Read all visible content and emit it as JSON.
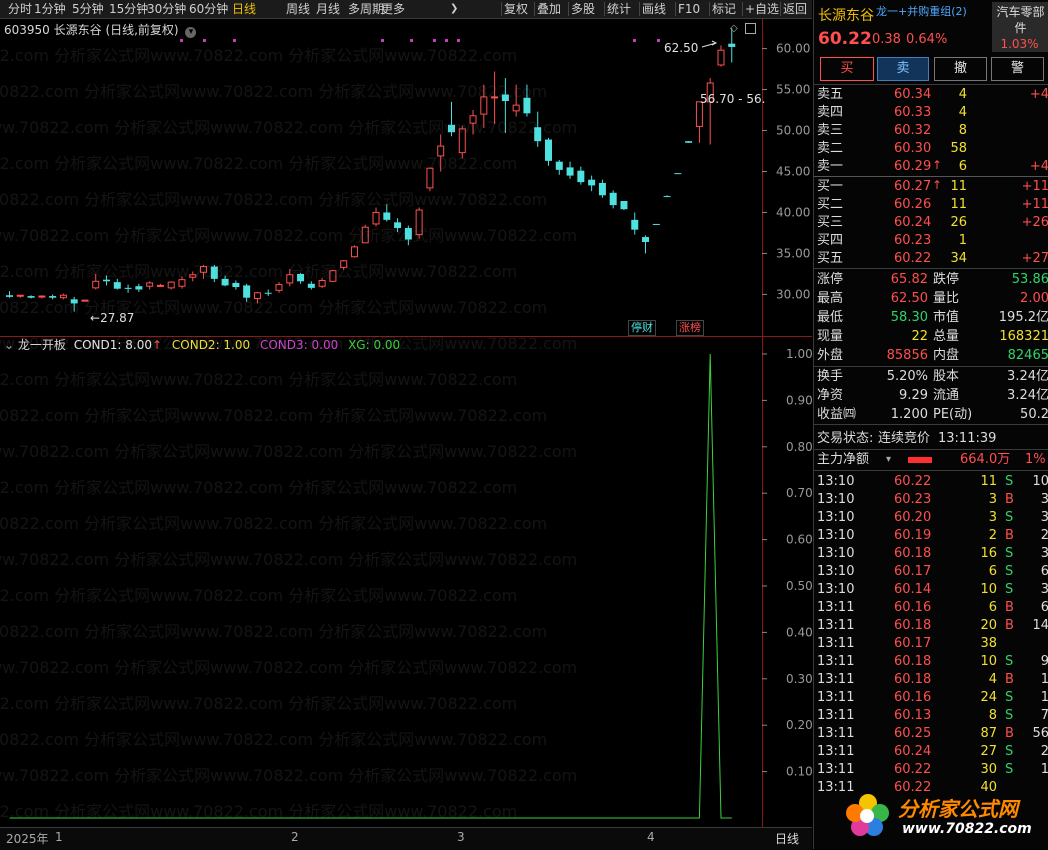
{
  "toolbar": {
    "periods": [
      "分时",
      "1分钟",
      "5分钟",
      "15分钟",
      "30分钟",
      "60分钟",
      "日线",
      "周线",
      "月线",
      "多周期",
      "更多"
    ],
    "active_period": "日线",
    "more_arrow": "❯",
    "actions": [
      "复权",
      "叠加",
      "多股",
      "统计",
      "画线",
      "F10",
      "标记",
      "+自选",
      "返回"
    ]
  },
  "chart": {
    "title": "603950 长源东谷 (日线,前复权)",
    "price_ticks": [
      "60.00",
      "55.00",
      "50.00",
      "45.00",
      "40.00",
      "35.00",
      "30.00"
    ],
    "high_label": "62.50",
    "low_label": "27.87",
    "right_label": "56.70 - 56.",
    "badge_tingcai": "停财",
    "badge_zhangbang": "涨榜"
  },
  "indicator": {
    "name": "龙一开板",
    "cond1": "COND1: 8.00",
    "cond1_arrow": "↑",
    "cond2": "COND2: 1.00",
    "cond3": "COND3: 0.00",
    "xg": "XG: 0.00",
    "ticks": [
      "1.00",
      "0.90",
      "0.80",
      "0.70",
      "0.60",
      "0.50",
      "0.40",
      "0.30",
      "0.20",
      "0.10"
    ]
  },
  "time_axis": {
    "year": "2025年",
    "months": [
      "1",
      "2",
      "3",
      "4"
    ],
    "period_label": "日线"
  },
  "stock": {
    "name": "长源东谷",
    "tags": "龙一+并购重组(2)",
    "sector": "汽车零部件",
    "sector_change": "1.03%",
    "price": "60.22",
    "change": "0.38",
    "change_pct": "0.64%"
  },
  "trade_buttons": [
    "买",
    "卖",
    "撤",
    "警"
  ],
  "asks": [
    {
      "label": "卖五",
      "price": "60.34",
      "vol": "4",
      "chg": "+4"
    },
    {
      "label": "卖四",
      "price": "60.33",
      "vol": "4",
      "chg": ""
    },
    {
      "label": "卖三",
      "price": "60.32",
      "vol": "8",
      "chg": ""
    },
    {
      "label": "卖二",
      "price": "60.30",
      "vol": "58",
      "chg": ""
    },
    {
      "label": "卖一",
      "price": "60.29",
      "vol": "6",
      "chg": "+4"
    }
  ],
  "bids": [
    {
      "label": "买一",
      "price": "60.27",
      "vol": "11",
      "chg": "+11"
    },
    {
      "label": "买二",
      "price": "60.26",
      "vol": "11",
      "chg": "+11"
    },
    {
      "label": "买三",
      "price": "60.24",
      "vol": "26",
      "chg": "+26"
    },
    {
      "label": "买四",
      "price": "60.23",
      "vol": "1",
      "chg": ""
    },
    {
      "label": "买五",
      "price": "60.22",
      "vol": "34",
      "chg": "+27"
    }
  ],
  "stats": [
    {
      "l1": "涨停",
      "v1": "65.82",
      "l2": "跌停",
      "v2": "53.86"
    },
    {
      "l1": "最高",
      "v1": "62.50",
      "l2": "量比",
      "v2": "2.00"
    },
    {
      "l1": "最低",
      "v1": "58.30",
      "l2": "市值",
      "v2": "195.2亿"
    },
    {
      "l1": "现量",
      "v1": "22",
      "l2": "总量",
      "v2": "168321"
    },
    {
      "l1": "外盘",
      "v1": "85856",
      "l2": "内盘",
      "v2": "82465"
    }
  ],
  "stats2": [
    {
      "l1": "换手",
      "v1": "5.20%",
      "l2": "股本",
      "v2": "3.24亿"
    },
    {
      "l1": "净资",
      "v1": "9.29",
      "l2": "流通",
      "v2": "3.24亿"
    },
    {
      "l1": "收益㈣",
      "v1": "1.200",
      "l2": "PE(动)",
      "v2": "50.2"
    }
  ],
  "status": {
    "label": "交易状态:",
    "value": "连续竞价",
    "time": "13:11:39"
  },
  "netflow": {
    "label": "主力净额",
    "amount": "664.0万",
    "pct": "1%"
  },
  "ticks": [
    {
      "t": "13:10",
      "p": "60.22",
      "v": "11",
      "s": "S",
      "x": "10"
    },
    {
      "t": "13:10",
      "p": "60.23",
      "v": "3",
      "s": "B",
      "x": "3"
    },
    {
      "t": "13:10",
      "p": "60.20",
      "v": "3",
      "s": "S",
      "x": "3"
    },
    {
      "t": "13:10",
      "p": "60.19",
      "v": "2",
      "s": "B",
      "x": "2"
    },
    {
      "t": "13:10",
      "p": "60.18",
      "v": "16",
      "s": "S",
      "x": "3"
    },
    {
      "t": "13:10",
      "p": "60.17",
      "v": "6",
      "s": "S",
      "x": "6"
    },
    {
      "t": "13:10",
      "p": "60.14",
      "v": "10",
      "s": "S",
      "x": "3"
    },
    {
      "t": "13:11",
      "p": "60.16",
      "v": "6",
      "s": "B",
      "x": "6"
    },
    {
      "t": "13:11",
      "p": "60.18",
      "v": "20",
      "s": "B",
      "x": "14"
    },
    {
      "t": "13:11",
      "p": "60.17",
      "v": "38",
      "s": "",
      "x": ""
    },
    {
      "t": "13:11",
      "p": "60.18",
      "v": "10",
      "s": "S",
      "x": "9"
    },
    {
      "t": "13:11",
      "p": "60.18",
      "v": "4",
      "s": "B",
      "x": "1"
    },
    {
      "t": "13:11",
      "p": "60.16",
      "v": "24",
      "s": "S",
      "x": "1"
    },
    {
      "t": "13:11",
      "p": "60.13",
      "v": "8",
      "s": "S",
      "x": "7"
    },
    {
      "t": "13:11",
      "p": "60.25",
      "v": "87",
      "s": "B",
      "x": "56"
    },
    {
      "t": "13:11",
      "p": "60.24",
      "v": "27",
      "s": "S",
      "x": "2"
    },
    {
      "t": "13:11",
      "p": "60.22",
      "v": "30",
      "s": "S",
      "x": "1"
    },
    {
      "t": "13:11",
      "p": "60.22",
      "v": "40",
      "s": "",
      "x": ""
    }
  ],
  "watermark": {
    "line": "分析家公式网www.70822.com 分析家公式网www.70822.com 分析家公式网www.70822.com",
    "logo": "分析家公式网",
    "logo_url": "www.70822.com"
  },
  "colors": {
    "up": "#ff4f4f",
    "down": "#4fe0e0",
    "indicator_line": "#3cd13c",
    "active": "#f0c000"
  },
  "chart_data": {
    "type": "candlestick",
    "ylim": [
      27,
      63
    ],
    "candles": [
      [
        29.9,
        30.4,
        29.7,
        29.6
      ],
      [
        29.9,
        29.8,
        29.9,
        29.6
      ],
      [
        29.8,
        29.9,
        29.6,
        29.5
      ],
      [
        29.7,
        29.9,
        29.8,
        29.5
      ],
      [
        29.8,
        30.0,
        29.6,
        29.4
      ],
      [
        29.6,
        30.1,
        29.9,
        29.4
      ],
      [
        29.4,
        29.7,
        28.9,
        27.9
      ],
      [
        29.2,
        31.1,
        29.3,
        31.1
      ],
      [
        30.8,
        32.5,
        31.6,
        30.6
      ],
      [
        31.8,
        32.3,
        31.6,
        31.1
      ],
      [
        31.5,
        31.9,
        30.7,
        30.6
      ],
      [
        30.8,
        31.2,
        30.7,
        30.2
      ],
      [
        31.0,
        31.3,
        30.6,
        30.3
      ],
      [
        31.0,
        31.6,
        31.4,
        30.6
      ],
      [
        31.1,
        31.3,
        31.1,
        30.9
      ],
      [
        30.8,
        31.6,
        31.5,
        30.6
      ],
      [
        31.0,
        32.2,
        31.8,
        30.7
      ],
      [
        32.1,
        32.8,
        32.4,
        31.6
      ],
      [
        32.7,
        33.6,
        33.4,
        31.9
      ],
      [
        33.4,
        33.6,
        31.9,
        31.5
      ],
      [
        31.9,
        32.3,
        31.1,
        31.0
      ],
      [
        31.4,
        31.7,
        30.9,
        30.6
      ],
      [
        31.1,
        31.3,
        29.6,
        29.1
      ],
      [
        29.5,
        30.3,
        30.2,
        28.9
      ],
      [
        30.2,
        30.6,
        30.1,
        29.8
      ],
      [
        30.5,
        31.5,
        31.2,
        30.2
      ],
      [
        31.4,
        33.1,
        32.4,
        31.0
      ],
      [
        32.5,
        32.6,
        31.6,
        31.3
      ],
      [
        31.3,
        31.6,
        30.8,
        30.6
      ],
      [
        31.0,
        32.0,
        31.7,
        30.8
      ],
      [
        31.6,
        33.0,
        32.9,
        31.5
      ],
      [
        33.3,
        34.2,
        34.1,
        33.0
      ],
      [
        34.6,
        36.0,
        35.8,
        34.5
      ],
      [
        36.3,
        38.5,
        38.2,
        36.3
      ],
      [
        38.6,
        40.6,
        40.0,
        38.3
      ],
      [
        40.0,
        41.0,
        39.1,
        38.9
      ],
      [
        38.8,
        39.3,
        38.1,
        37.6
      ],
      [
        38.1,
        38.4,
        36.7,
        36.0
      ],
      [
        37.3,
        40.6,
        40.3,
        36.8
      ],
      [
        43.0,
        45.5,
        45.4,
        42.6
      ],
      [
        46.9,
        49.5,
        48.1,
        45.0
      ],
      [
        50.7,
        53.5,
        49.8,
        49.3
      ],
      [
        47.3,
        50.6,
        50.2,
        46.6
      ],
      [
        50.9,
        52.5,
        51.8,
        49.5
      ],
      [
        52.0,
        55.6,
        54.1,
        50.3
      ],
      [
        54.1,
        57.2,
        54.1,
        50.8
      ],
      [
        54.4,
        56.4,
        53.6,
        49.7
      ],
      [
        52.4,
        55.6,
        53.1,
        51.7
      ],
      [
        54.0,
        55.6,
        52.1,
        51.7
      ],
      [
        50.4,
        52.3,
        48.7,
        48.0
      ],
      [
        48.9,
        49.1,
        46.3,
        45.7
      ],
      [
        46.2,
        46.4,
        45.2,
        44.6
      ],
      [
        45.5,
        46.2,
        44.5,
        44.1
      ],
      [
        45.1,
        45.6,
        43.7,
        43.4
      ],
      [
        44.0,
        44.5,
        43.3,
        42.6
      ],
      [
        43.6,
        44.0,
        42.1,
        41.8
      ],
      [
        42.4,
        42.7,
        40.9,
        40.5
      ],
      [
        41.4,
        41.4,
        40.4,
        40.3
      ],
      [
        39.1,
        40.0,
        37.9,
        37.3
      ],
      [
        37.0,
        37.2,
        36.4,
        35.0
      ],
      [
        38.6,
        38.6,
        38.5,
        38.5
      ],
      [
        42.0,
        42.1,
        41.9,
        41.9
      ],
      [
        44.8,
        44.8,
        44.7,
        44.7
      ],
      [
        48.7,
        48.7,
        48.5,
        48.5
      ],
      [
        50.5,
        53.5,
        53.5,
        48.5
      ],
      [
        53.5,
        56.4,
        55.8,
        48.3
      ],
      [
        58.0,
        60.4,
        59.8,
        57.8
      ],
      [
        60.6,
        62.5,
        60.2,
        58.3
      ]
    ],
    "indicator_series": [
      0,
      0,
      0,
      0,
      0,
      0,
      0,
      0,
      0,
      0,
      0,
      0,
      0,
      0,
      0,
      0,
      0,
      0,
      0,
      0,
      0,
      0,
      0,
      0,
      0,
      0,
      0,
      0,
      0,
      0,
      0,
      0,
      0,
      0,
      0,
      0,
      0,
      0,
      0,
      0,
      0,
      0,
      0,
      0,
      0,
      0,
      0,
      0,
      0,
      0,
      0,
      0,
      0,
      0,
      0,
      0,
      0,
      0,
      0,
      0,
      0,
      0,
      0,
      0,
      0,
      1,
      0,
      0
    ]
  }
}
